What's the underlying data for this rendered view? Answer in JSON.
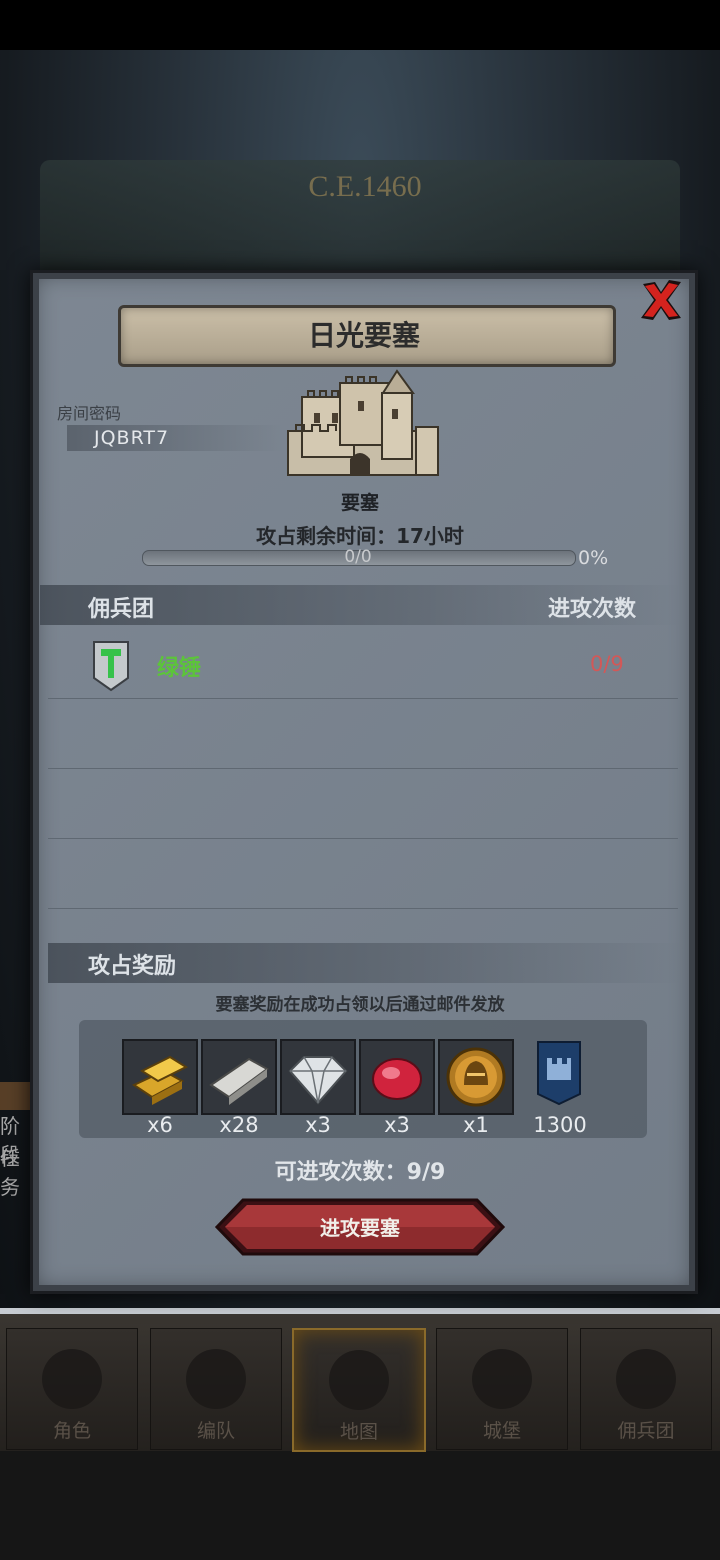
{
  "map": {
    "era": "C.E.1460"
  },
  "left_hud": {
    "line1": "阶段",
    "line2": "任务"
  },
  "dialog": {
    "title": "日光要塞",
    "room_code_label": "房间密码",
    "room_code": "JQBRT7",
    "fortress_name": "要塞",
    "time_left": "攻占剩余时间：17小时",
    "progress_text": "0/0",
    "progress_percent": "0%",
    "progress_value": 0,
    "mercenary_header": "佣兵团",
    "attack_count_header": "进攻次数",
    "guilds": [
      {
        "name": "绿锤",
        "attacks": "0/9"
      }
    ],
    "reward_header": "攻占奖励",
    "reward_note": "要塞奖励在成功占领以后通过邮件发放",
    "rewards": [
      {
        "icon": "gold-bars-icon",
        "qty": "x6"
      },
      {
        "icon": "iron-ingot-icon",
        "qty": "x28"
      },
      {
        "icon": "diamond-icon",
        "qty": "x3"
      },
      {
        "icon": "ruby-icon",
        "qty": "x3"
      },
      {
        "icon": "knight-helmet-coin-icon",
        "qty": "x1"
      },
      {
        "icon": "castle-banner-icon",
        "qty": "1300"
      }
    ],
    "attempts_left": "可进攻次数：9/9",
    "attack_button": "进攻要塞"
  },
  "nav": {
    "tabs": [
      {
        "label": "角色",
        "icon": "knight-icon"
      },
      {
        "label": "编队",
        "icon": "helmet-icon"
      },
      {
        "label": "地图",
        "icon": "compass-icon",
        "active": true
      },
      {
        "label": "城堡",
        "icon": "castle-icon"
      },
      {
        "label": "佣兵团",
        "icon": "mercenary-icon"
      }
    ]
  }
}
